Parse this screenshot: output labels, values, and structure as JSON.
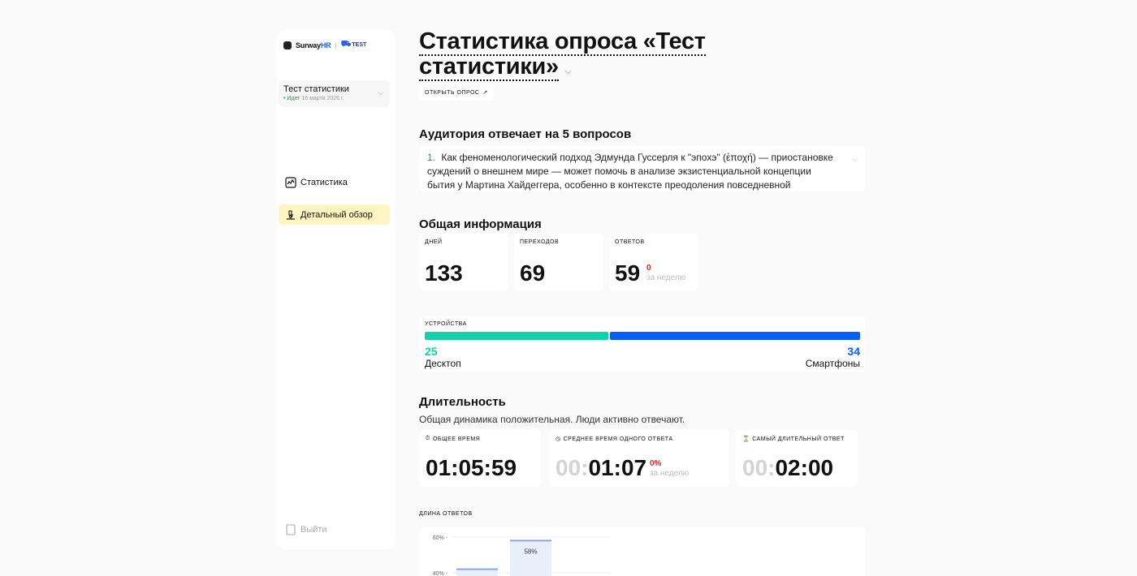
{
  "sidebar": {
    "logo_brand": "Surway",
    "logo_hr": "HR",
    "logo_test": "TEST",
    "survey": {
      "name": "Тест статистики",
      "status": "• Идет",
      "date": "16 марта 2026 г."
    },
    "nav": [
      {
        "label": "Статистика",
        "icon": "chart-icon"
      },
      {
        "label": "Детальный обзор",
        "icon": "microscope-icon",
        "active": true
      }
    ],
    "logout_label": "Выйти"
  },
  "header": {
    "title_line1": "Статистика опроса «Тест",
    "title_line2": "статистики»",
    "open_button": "ОТКРЫТЬ ОПРОС"
  },
  "audience": {
    "heading": "Аудитория отвечает на 5 вопросов",
    "question_number": "1.",
    "question_text": "Как феноменологический подход Эдмунда Гуссерля к \"эпохэ\" (ἐποχή) — приостановке суждений о внешнем мире — может помочь в анализе экзистенциальной концепции бытия у Мартина Хайдеггера, особенно в контексте преодоления повседневной анонимности \"Das"
  },
  "general": {
    "heading": "Общая информация",
    "cards": [
      {
        "label": "ДНЕЙ",
        "value": "133"
      },
      {
        "label": "ПЕРЕХОДОВ",
        "value": "69"
      },
      {
        "label": "ОТВЕТОВ",
        "value": "59",
        "delta": "0",
        "sub": "за неделю"
      }
    ]
  },
  "devices": {
    "label": "УСТРОЙСТВА",
    "desktop": {
      "count": "25",
      "name": "Десктоп",
      "color": "#0fd2a8"
    },
    "mobile": {
      "count": "34",
      "name": "Смартфоны",
      "color": "#0a5cff"
    },
    "desktop_share": 0.4237
  },
  "duration": {
    "heading": "Длительность",
    "description": "Общая динамика положительная. Люди активно отвечают.",
    "cards": [
      {
        "label": "ОБЩЕЕ ВРЕМЯ",
        "icon": "stopwatch-icon",
        "dim": "",
        "value": "01:05:59"
      },
      {
        "label": "СРЕДНЕЕ ВРЕМЯ ОДНОГО ОТВЕТА",
        "icon": "clock-icon",
        "dim": "00:",
        "value": "01:07",
        "delta": "0%",
        "sub": "за неделю"
      },
      {
        "label": "САМЫЙ ДЛИТЕЛЬНЫЙ ОТВЕТ",
        "icon": "hourglass-icon",
        "dim": "00:",
        "value": "02:00"
      }
    ]
  },
  "answer_length": {
    "label": "ДЛИНА ОТВЕТОВ"
  },
  "chart_data": {
    "type": "bar",
    "categories": [
      "",
      ""
    ],
    "values": [
      42,
      58
    ],
    "data_labels": [
      "",
      "58%"
    ],
    "yticks": [
      "60%",
      "40%"
    ],
    "ylim": [
      0,
      60
    ],
    "colors": {
      "bar": "#e9eefb",
      "bar_top": "#8aa7e8"
    }
  }
}
